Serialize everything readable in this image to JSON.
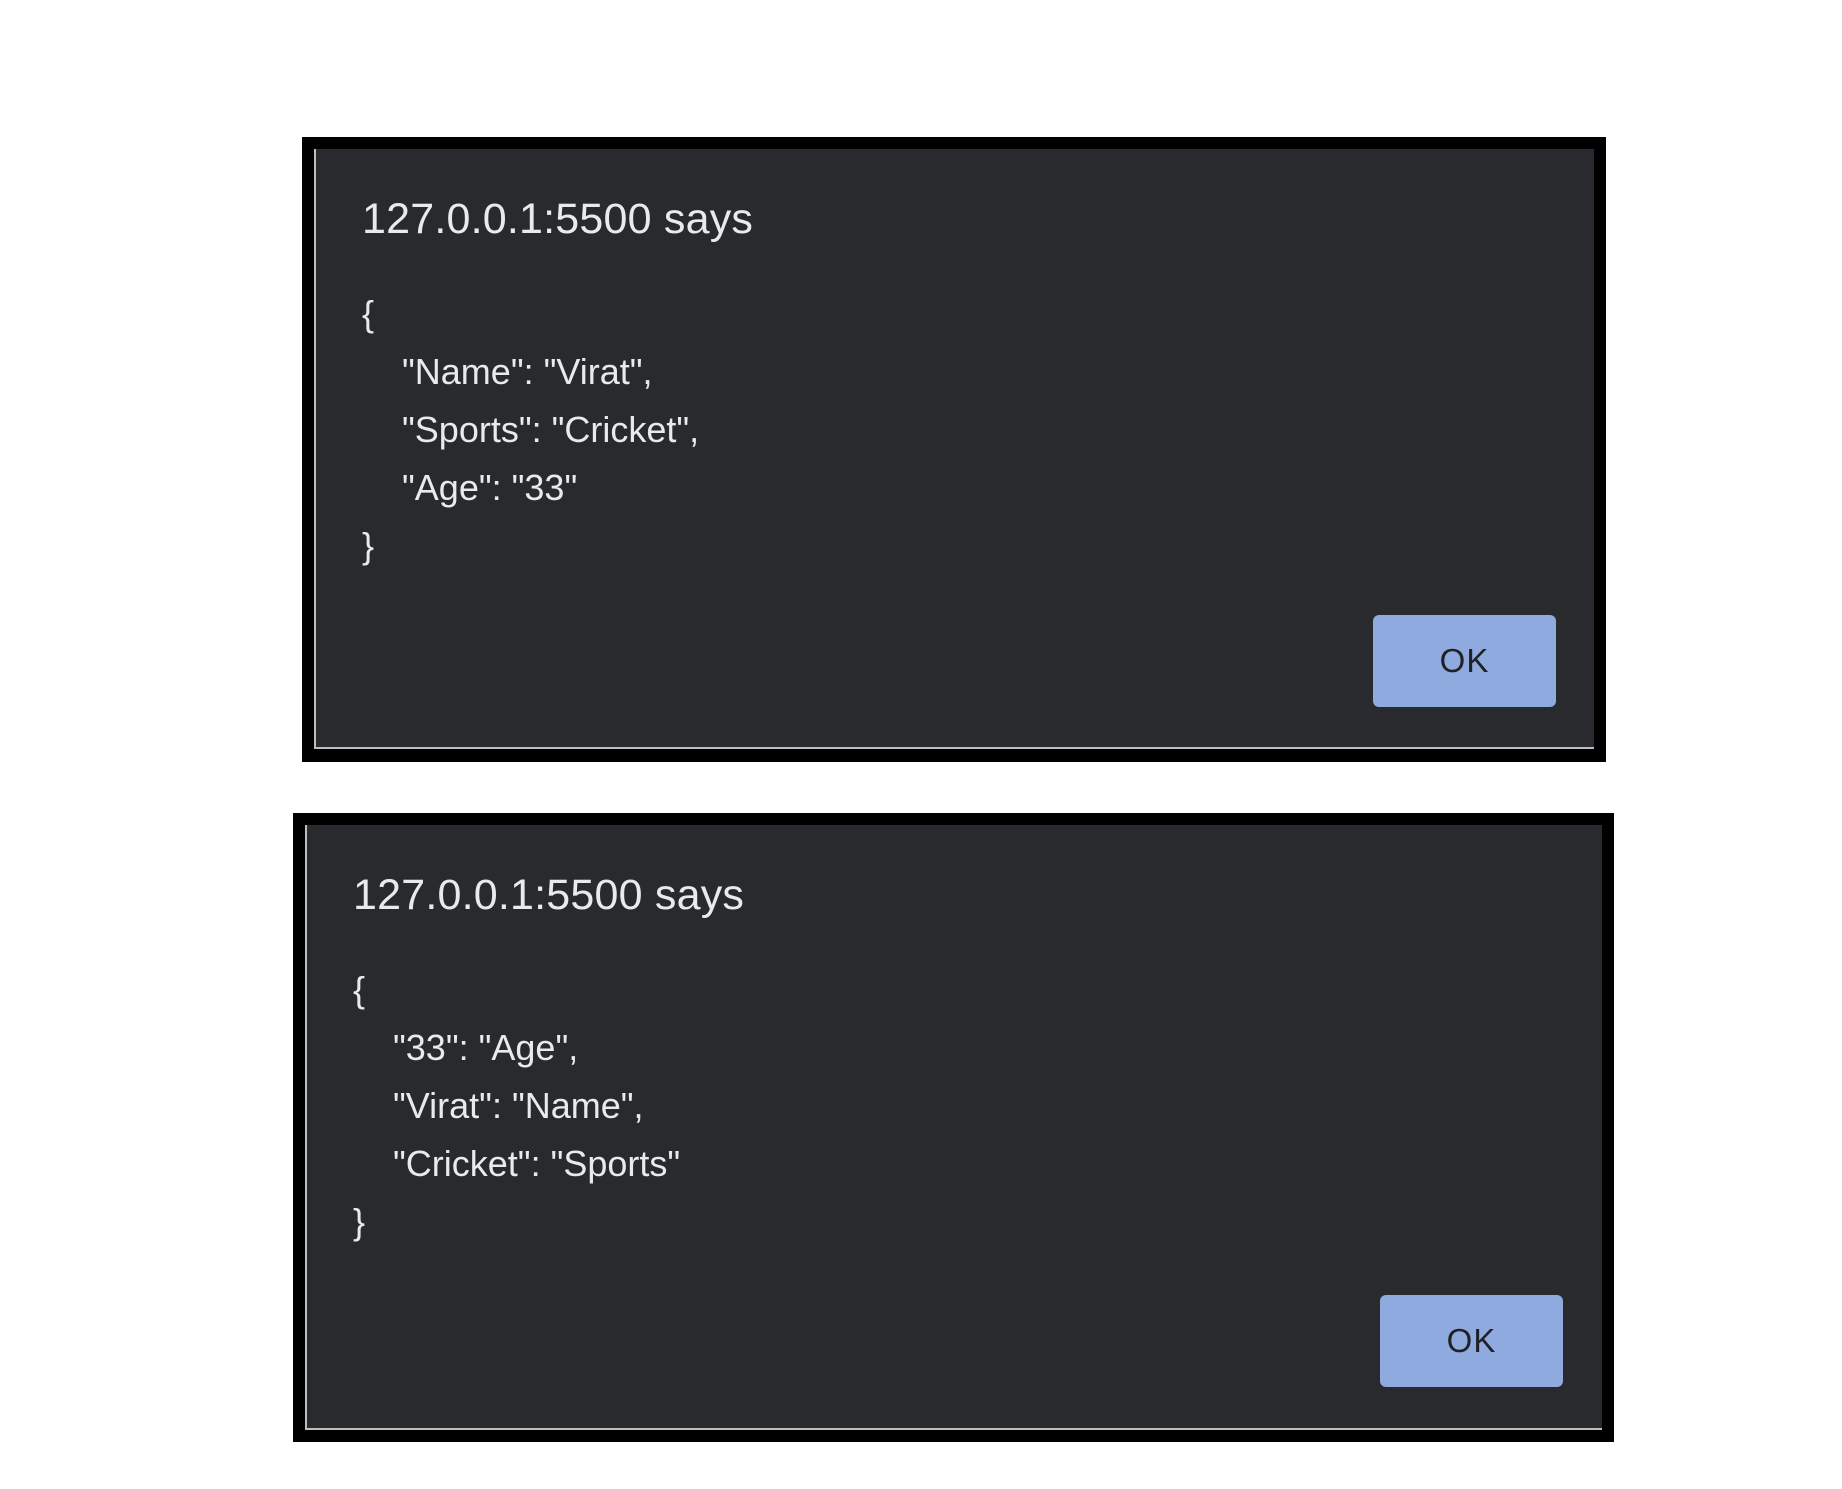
{
  "dialogs": [
    {
      "title": "127.0.0.1:5500 says",
      "message": "{\n    \"Name\": \"Virat\",\n    \"Sports\": \"Cricket\",\n    \"Age\": \"33\"\n}",
      "ok_label": "OK"
    },
    {
      "title": "127.0.0.1:5500 says",
      "message": "{\n    \"33\": \"Age\",\n    \"Virat\": \"Name\",\n    \"Cricket\": \"Sports\"\n}",
      "ok_label": "OK"
    }
  ],
  "colors": {
    "dialog_background": "#292a2d",
    "text": "#e8eaed",
    "button": "#8eaadf",
    "frame": "#000000"
  }
}
